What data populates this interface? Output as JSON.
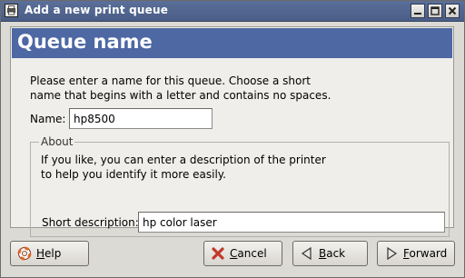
{
  "window": {
    "title": "Add a new print queue"
  },
  "banner": {
    "title": "Queue name"
  },
  "intro": {
    "line1": "Please enter a name for this queue.  Choose a short",
    "line2": "name that begins with a letter and contains no spaces."
  },
  "name_field": {
    "label": "Name:",
    "value": "hp8500"
  },
  "about": {
    "legend": "About",
    "line1": "If you like, you can enter a description of the printer",
    "line2": "to help you identify it more easily.",
    "short_label": "Short description:",
    "short_value": "hp color laser"
  },
  "buttons": {
    "help_first": "H",
    "help_rest": "elp",
    "cancel_first": "C",
    "cancel_rest": "ancel",
    "back_first": "B",
    "back_rest": "ack",
    "forward_first": "F",
    "forward_rest": "orward"
  },
  "colors": {
    "titlebar": "#4a5d86",
    "banner": "#4d68a3",
    "cancel_icon": "#c0392b",
    "help_icon": "#d96a2b"
  },
  "icons": {
    "window": "printer-window-icon",
    "minimize": "minimize-icon",
    "maximize": "maximize-icon",
    "close": "close-icon",
    "help": "help-lifebuoy-icon",
    "cancel": "cancel-x-icon",
    "back": "back-arrow-icon",
    "forward": "forward-arrow-icon"
  }
}
